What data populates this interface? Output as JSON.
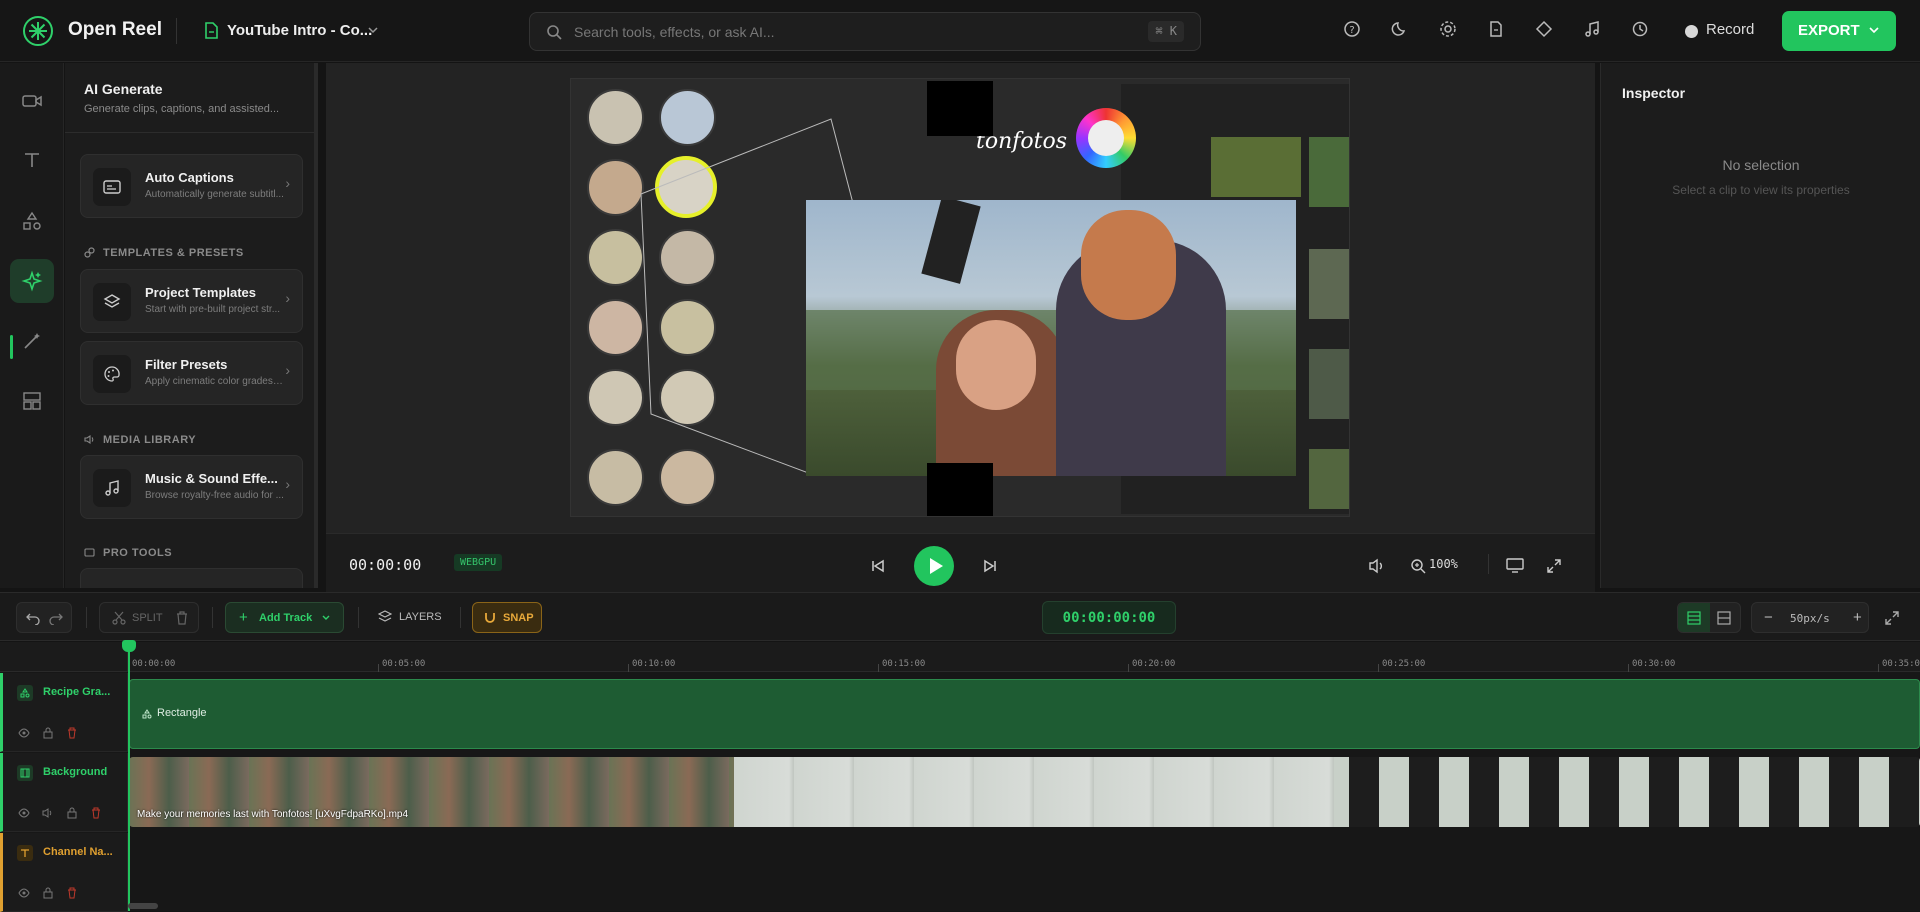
{
  "app": {
    "title": "Open Reel",
    "project_name": "YouTube Intro - Co...",
    "search_placeholder": "Search tools, effects, or ask AI...",
    "search_shortcut": "⌘ K",
    "record_label": "Record",
    "export_label": "EXPORT",
    "accent_color": "#22c55e"
  },
  "topbar_icons": [
    "help-icon",
    "theme-moon-icon",
    "settings-gear-icon",
    "document-icon",
    "diamond-icon",
    "music-note-icon",
    "history-icon"
  ],
  "rail": {
    "items": [
      "video-icon",
      "text-icon",
      "shapes-icon",
      "ai-sparkle-icon",
      "magic-wand-icon",
      "layout-icon"
    ],
    "active_index": 3
  },
  "panel": {
    "title": "AI Generate",
    "subtitle": "Generate clips, captions, and assisted...",
    "cards": [
      {
        "title": "Auto Captions",
        "desc": "Automatically generate subtitl..."
      },
      {
        "title": "Project Templates",
        "desc": "Start with pre-built project str..."
      },
      {
        "title": "Filter Presets",
        "desc": "Apply cinematic color grades i..."
      },
      {
        "title": "Music & Sound Effe...",
        "desc": "Browse royalty-free audio for ..."
      }
    ],
    "sections": {
      "templates": "TEMPLATES & PRESETS",
      "media": "MEDIA LIBRARY",
      "pro": "PRO TOOLS"
    }
  },
  "preview": {
    "watermark_text": "tonfotos",
    "timecode": "00:00:00",
    "renderer_badge": "WEBGPU",
    "zoom": "100%"
  },
  "inspector": {
    "title": "Inspector",
    "empty_title": "No selection",
    "empty_hint": "Select a clip to view its properties"
  },
  "timeline_toolbar": {
    "split_label": "SPLIT",
    "add_track_label": "Add Track",
    "layers_label": "LAYERS",
    "snap_label": "SNAP",
    "timecode": "00:00:00:00",
    "zoom_label": "50px/s"
  },
  "ruler_ticks": [
    "00:00:00",
    "00:05:00",
    "00:10:00",
    "00:15:00",
    "00:20:00",
    "00:25:00",
    "00:30:00",
    "00:35:00"
  ],
  "tracks": [
    {
      "name": "Recipe Gra...",
      "color": "#2fd06a",
      "type": "graphics",
      "clip_label": "Rectangle"
    },
    {
      "name": "Background",
      "color": "#2fd06a",
      "type": "video",
      "clip_label": "Make your memories last with Tonfotos! [uXvgFdpaRKo].mp4"
    },
    {
      "name": "Channel Na...",
      "color": "#e0a030",
      "type": "text",
      "clip_label": ""
    }
  ]
}
